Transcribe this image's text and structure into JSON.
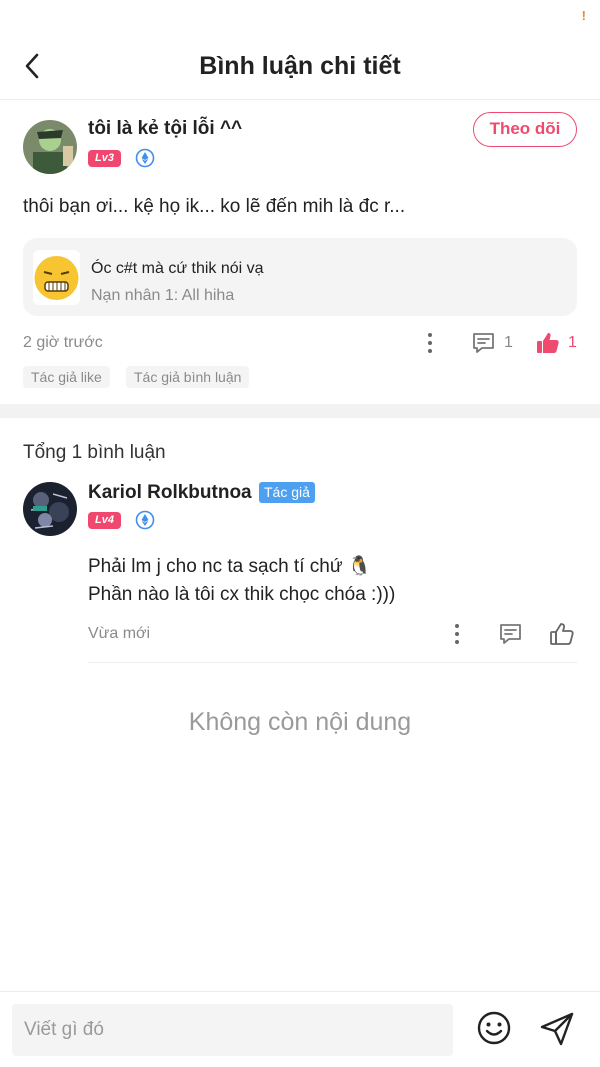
{
  "status": {
    "alert": "!"
  },
  "header": {
    "title": "Bình luận chi tiết"
  },
  "post": {
    "author": "tôi là kẻ tội lỗi ^^",
    "level": "Lv3",
    "follow_label": "Theo dõi",
    "text": "thôi bạn ơi... kệ họ ik... ko lẽ đến mih là đc r...",
    "quote": {
      "title": "Óc c#t mà cứ thik nói vạ",
      "subtitle": "Nạn nhân 1: All hiha"
    },
    "time": "2 giờ trước",
    "comment_count": "1",
    "like_count": "1",
    "tags": [
      "Tác giả like",
      "Tác giả bình luận"
    ]
  },
  "comments": {
    "total_label": "Tổng 1 bình luận",
    "items": [
      {
        "author": "Kariol Rolkbutnoa",
        "author_badge": "Tác giả",
        "level": "Lv4",
        "lines": [
          "Phải lm j cho nc ta sạch tí chứ 🐧",
          "Phần nào là tôi cx thik chọc chóa :)))"
        ],
        "time": "Vừa mới"
      }
    ],
    "end_label": "Không còn nội dung"
  },
  "composer": {
    "placeholder": "Viết gì đó"
  },
  "colors": {
    "accent": "#ef4a6f",
    "author_badge": "#4d9ff0",
    "muted": "#8a8a8a"
  }
}
